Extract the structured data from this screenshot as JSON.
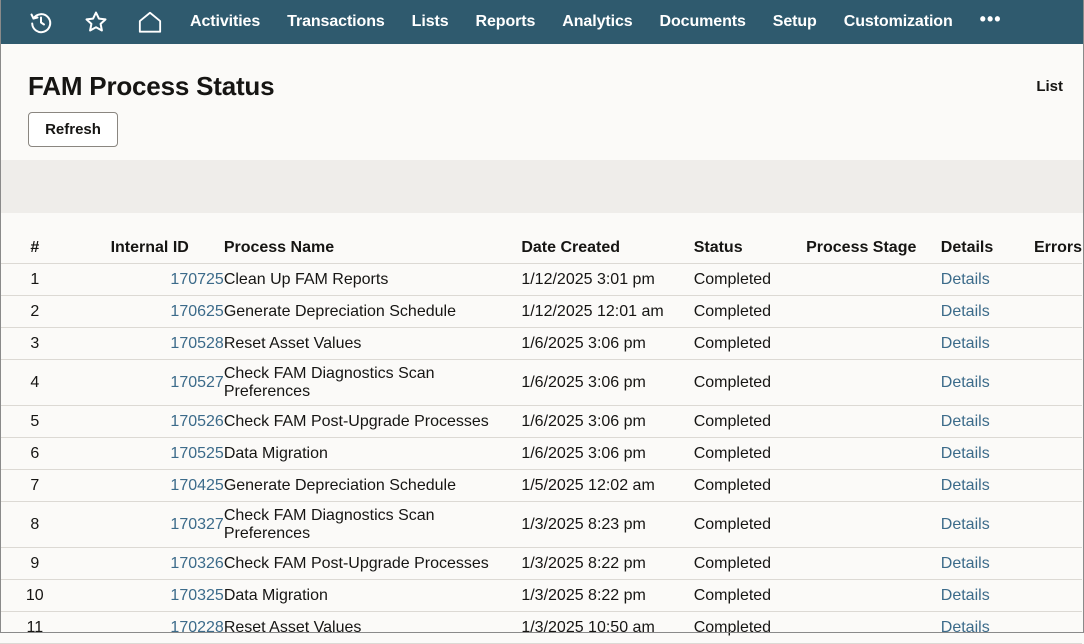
{
  "nav": {
    "icons": [
      "history-icon",
      "star-icon",
      "home-icon"
    ],
    "items": [
      "Activities",
      "Transactions",
      "Lists",
      "Reports",
      "Analytics",
      "Documents",
      "Setup",
      "Customization"
    ],
    "more": "•••"
  },
  "page": {
    "title": "FAM Process Status",
    "list_link": "List",
    "refresh_label": "Refresh"
  },
  "table": {
    "headers": [
      "#",
      "Internal ID",
      "Process Name",
      "Date Created",
      "Status",
      "Process Stage",
      "Details",
      "Errors"
    ],
    "rows": [
      {
        "num": "1",
        "id": "170725",
        "name": "Clean Up FAM Reports",
        "date": "1/12/2025 3:01 pm",
        "status": "Completed",
        "stage": "",
        "details": "Details",
        "errors": ""
      },
      {
        "num": "2",
        "id": "170625",
        "name": "Generate Depreciation Schedule",
        "date": "1/12/2025 12:01 am",
        "status": "Completed",
        "stage": "",
        "details": "Details",
        "errors": ""
      },
      {
        "num": "3",
        "id": "170528",
        "name": "Reset Asset Values",
        "date": "1/6/2025 3:06 pm",
        "status": "Completed",
        "stage": "",
        "details": "Details",
        "errors": ""
      },
      {
        "num": "4",
        "id": "170527",
        "name": "Check FAM Diagnostics Scan Preferences",
        "date": "1/6/2025 3:06 pm",
        "status": "Completed",
        "stage": "",
        "details": "Details",
        "errors": ""
      },
      {
        "num": "5",
        "id": "170526",
        "name": "Check FAM Post-Upgrade Processes",
        "date": "1/6/2025 3:06 pm",
        "status": "Completed",
        "stage": "",
        "details": "Details",
        "errors": ""
      },
      {
        "num": "6",
        "id": "170525",
        "name": "Data Migration",
        "date": "1/6/2025 3:06 pm",
        "status": "Completed",
        "stage": "",
        "details": "Details",
        "errors": ""
      },
      {
        "num": "7",
        "id": "170425",
        "name": "Generate Depreciation Schedule",
        "date": "1/5/2025 12:02 am",
        "status": "Completed",
        "stage": "",
        "details": "Details",
        "errors": ""
      },
      {
        "num": "8",
        "id": "170327",
        "name": "Check FAM Diagnostics Scan Preferences",
        "date": "1/3/2025 8:23 pm",
        "status": "Completed",
        "stage": "",
        "details": "Details",
        "errors": ""
      },
      {
        "num": "9",
        "id": "170326",
        "name": "Check FAM Post-Upgrade Processes",
        "date": "1/3/2025 8:22 pm",
        "status": "Completed",
        "stage": "",
        "details": "Details",
        "errors": ""
      },
      {
        "num": "10",
        "id": "170325",
        "name": "Data Migration",
        "date": "1/3/2025 8:22 pm",
        "status": "Completed",
        "stage": "",
        "details": "Details",
        "errors": ""
      },
      {
        "num": "11",
        "id": "170228",
        "name": "Reset Asset Values",
        "date": "1/3/2025 10:50 am",
        "status": "Completed",
        "stage": "",
        "details": "Details",
        "errors": ""
      }
    ]
  },
  "colors": {
    "navbar": "#2f5a6e",
    "link": "#3c6b8a",
    "filter_band": "#efedea",
    "background": "#fbfaf8"
  }
}
